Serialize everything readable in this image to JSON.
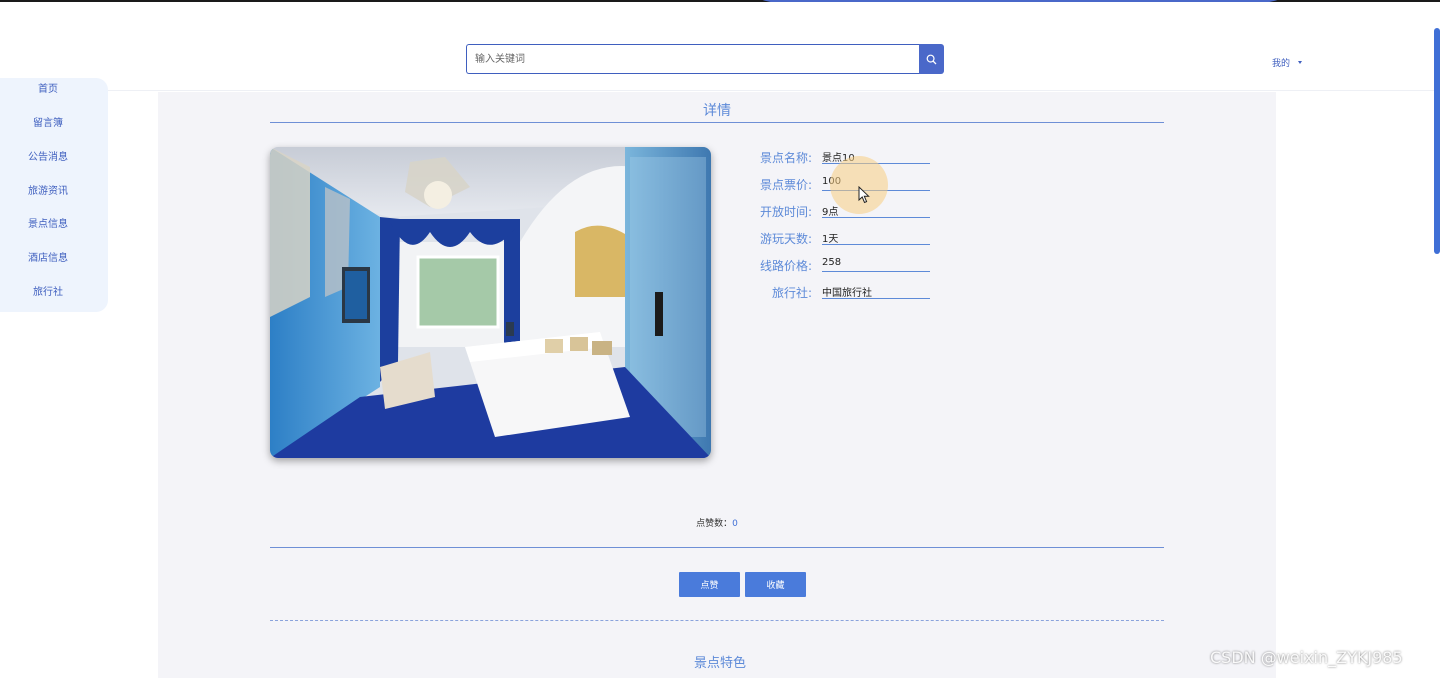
{
  "header": {
    "search_placeholder": "输入关键词",
    "mine_label": "我的"
  },
  "sidebar": {
    "items": [
      {
        "label": "首页"
      },
      {
        "label": "留言簿"
      },
      {
        "label": "公告消息"
      },
      {
        "label": "旅游资讯"
      },
      {
        "label": "景点信息"
      },
      {
        "label": "酒店信息"
      },
      {
        "label": "旅行社"
      }
    ]
  },
  "main": {
    "title": "详情",
    "fields": [
      {
        "label": "景点名称:",
        "value": "景点10"
      },
      {
        "label": "景点票价:",
        "value": "100"
      },
      {
        "label": "开放时间:",
        "value": "9点"
      },
      {
        "label": "游玩天数:",
        "value": "1天"
      },
      {
        "label": "线路价格:",
        "value": "258"
      },
      {
        "label": "旅行社:",
        "value": "中国旅行社"
      }
    ],
    "likes_label": "点赞数：",
    "likes_count": "0",
    "like_button": "点赞",
    "collect_button": "收藏",
    "section_title": "景点特色"
  },
  "watermark": "CSDN @weixin_ZYKJ985",
  "colors": {
    "accent": "#4a7bdb",
    "brand_blue": "#3f5fbf",
    "label_blue": "#5d8ad8",
    "panel_bg": "#f4f4f8"
  },
  "icons": [
    "search-icon",
    "chevron-down-icon",
    "mouse-cursor-icon"
  ]
}
